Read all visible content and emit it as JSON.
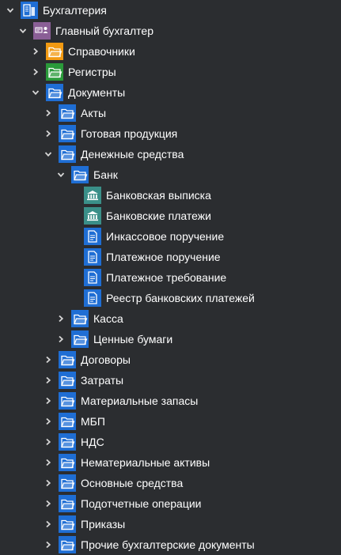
{
  "colors": {
    "background": "#2b2d30",
    "text": "#ffffff",
    "chevron": "#d6d6d6",
    "folder_blue": "#1f6ed4",
    "folder_orange": "#f29a12",
    "folder_green": "#2a9a3a",
    "bank_teal": "#3a8f88",
    "doc_blue": "#1f6ed4",
    "role_purple": "#8a5f96",
    "app_blue": "#1f6ed4"
  },
  "tree": [
    {
      "label": "Бухгалтерия",
      "level": 0,
      "chevron": "down",
      "icon": "app-icon"
    },
    {
      "label": "Главный бухгалтер",
      "level": 1,
      "chevron": "down",
      "icon": "role-icon"
    },
    {
      "label": "Справочники",
      "level": 2,
      "chevron": "right",
      "icon": "folder-orange-icon"
    },
    {
      "label": "Регистры",
      "level": 2,
      "chevron": "right",
      "icon": "folder-green-icon"
    },
    {
      "label": "Документы",
      "level": 2,
      "chevron": "down",
      "icon": "folder-blue-icon"
    },
    {
      "label": "Акты",
      "level": 3,
      "chevron": "right",
      "icon": "folder-blue-icon"
    },
    {
      "label": "Готовая продукция",
      "level": 3,
      "chevron": "right",
      "icon": "folder-blue-icon"
    },
    {
      "label": "Денежные средства",
      "level": 3,
      "chevron": "down",
      "icon": "folder-blue-icon"
    },
    {
      "label": "Банк",
      "level": 4,
      "chevron": "down",
      "icon": "folder-blue-icon"
    },
    {
      "label": "Банковская выписка",
      "level": 5,
      "chevron": "none",
      "icon": "bank-icon"
    },
    {
      "label": "Банковские платежи",
      "level": 5,
      "chevron": "none",
      "icon": "bank-icon"
    },
    {
      "label": "Инкассовое поручение",
      "level": 5,
      "chevron": "none",
      "icon": "document-icon"
    },
    {
      "label": "Платежное поручение",
      "level": 5,
      "chevron": "none",
      "icon": "document-icon"
    },
    {
      "label": "Платежное требование",
      "level": 5,
      "chevron": "none",
      "icon": "document-icon"
    },
    {
      "label": "Реестр банковских платежей",
      "level": 5,
      "chevron": "none",
      "icon": "document-icon"
    },
    {
      "label": "Касса",
      "level": 4,
      "chevron": "right",
      "icon": "folder-blue-icon"
    },
    {
      "label": "Ценные бумаги",
      "level": 4,
      "chevron": "right",
      "icon": "folder-blue-icon"
    },
    {
      "label": "Договоры",
      "level": 3,
      "chevron": "right",
      "icon": "folder-blue-icon"
    },
    {
      "label": "Затраты",
      "level": 3,
      "chevron": "right",
      "icon": "folder-blue-icon"
    },
    {
      "label": "Материальные запасы",
      "level": 3,
      "chevron": "right",
      "icon": "folder-blue-icon"
    },
    {
      "label": "МБП",
      "level": 3,
      "chevron": "right",
      "icon": "folder-blue-icon"
    },
    {
      "label": "НДС",
      "level": 3,
      "chevron": "right",
      "icon": "folder-blue-icon"
    },
    {
      "label": "Нематериальные активы",
      "level": 3,
      "chevron": "right",
      "icon": "folder-blue-icon"
    },
    {
      "label": "Основные средства",
      "level": 3,
      "chevron": "right",
      "icon": "folder-blue-icon"
    },
    {
      "label": "Подотчетные операции",
      "level": 3,
      "chevron": "right",
      "icon": "folder-blue-icon"
    },
    {
      "label": "Приказы",
      "level": 3,
      "chevron": "right",
      "icon": "folder-blue-icon"
    },
    {
      "label": "Прочие бухгалтерские документы",
      "level": 3,
      "chevron": "right",
      "icon": "folder-blue-icon"
    }
  ]
}
